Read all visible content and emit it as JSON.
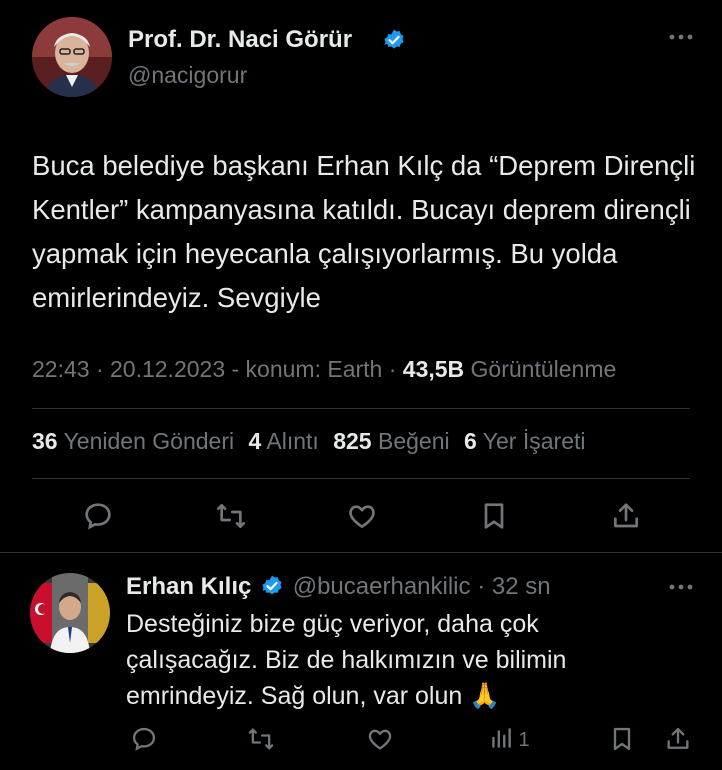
{
  "tweet": {
    "author_name": "Prof. Dr. Naci Görür",
    "author_handle": "@nacigorur",
    "text": "Buca belediye başkanı Erhan Kılç da “Deprem Dirençli Kentler” kampanyasına katıldı. Bucayı deprem dirençli yapmak için heyecanla çalışıyorlarmış. Bu yolda emirlerindeyiz. Sevgiyle",
    "meta_prefix": "22:43 · 20.12.2023 - konum: Earth ·",
    "views_count": "43,5B",
    "views_label": "Görüntülenme",
    "stats": [
      {
        "count": "36",
        "label": "Yeniden Gönderi"
      },
      {
        "count": "4",
        "label": "Alıntı"
      },
      {
        "count": "825",
        "label": "Beğeni"
      },
      {
        "count": "6",
        "label": "Yer İşareti"
      }
    ],
    "more_icon": "more-icon"
  },
  "reply": {
    "author_name": "Erhan Kılıç",
    "author_handle": "@bucaerhankilic",
    "time": "· 32 sn",
    "text": "Desteğiniz bize güç veriyor, daha çok çalışacağız. Biz de halkımızın ve bilimin emrindeyiz. Sağ olun, var olun 🙏",
    "views_count": "1"
  },
  "colors": {
    "background": "#000000",
    "text": "#e7e9ea",
    "muted": "#71767b",
    "verified": "#1d9bf0",
    "divider": "#2f3336"
  }
}
